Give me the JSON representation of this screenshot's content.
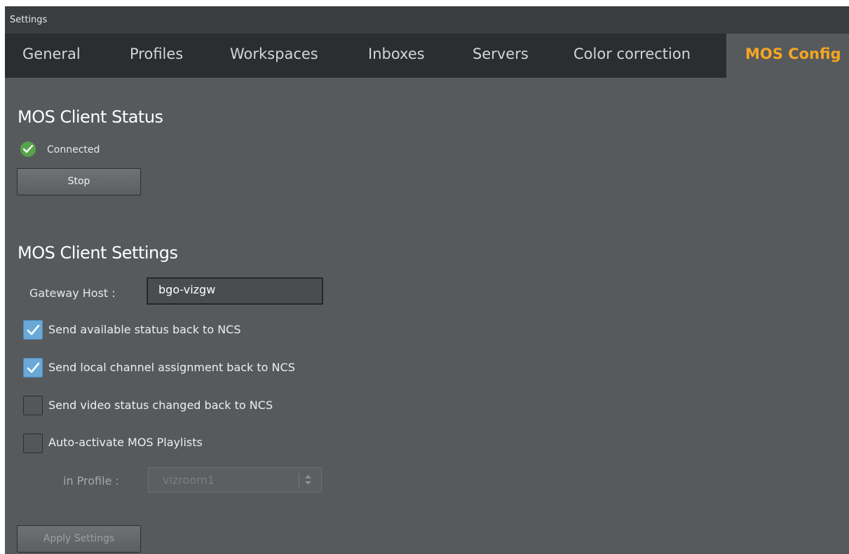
{
  "window": {
    "title": "Settings"
  },
  "tabs": [
    {
      "label": "General"
    },
    {
      "label": "Profiles"
    },
    {
      "label": "Workspaces"
    },
    {
      "label": "Inboxes"
    },
    {
      "label": "Servers"
    },
    {
      "label": "Color correction"
    },
    {
      "label": "MOS Config",
      "active": true
    }
  ],
  "status_section": {
    "title": "MOS Client Status",
    "status_text": "Connected",
    "status_icon": "check-circle-icon",
    "status_color": "#57a34a",
    "stop_label": "Stop"
  },
  "settings_section": {
    "title": "MOS Client Settings",
    "gateway_label": "Gateway Host :",
    "gateway_value": "bgo-vizgw",
    "checkboxes": [
      {
        "label": "Send available status back to NCS",
        "checked": true
      },
      {
        "label": "Send local channel assignment back to NCS",
        "checked": true
      },
      {
        "label": "Send video status changed back to NCS",
        "checked": false
      },
      {
        "label": "Auto-activate MOS Playlists",
        "checked": false
      }
    ],
    "profile_label": "in Profile :",
    "profile_value": "vizroom1",
    "apply_label": "Apply Settings"
  },
  "colors": {
    "accent_active_tab": "#f5a623",
    "checkbox_checked": "#6aa8d8",
    "panel_bg": "#575a5c"
  }
}
